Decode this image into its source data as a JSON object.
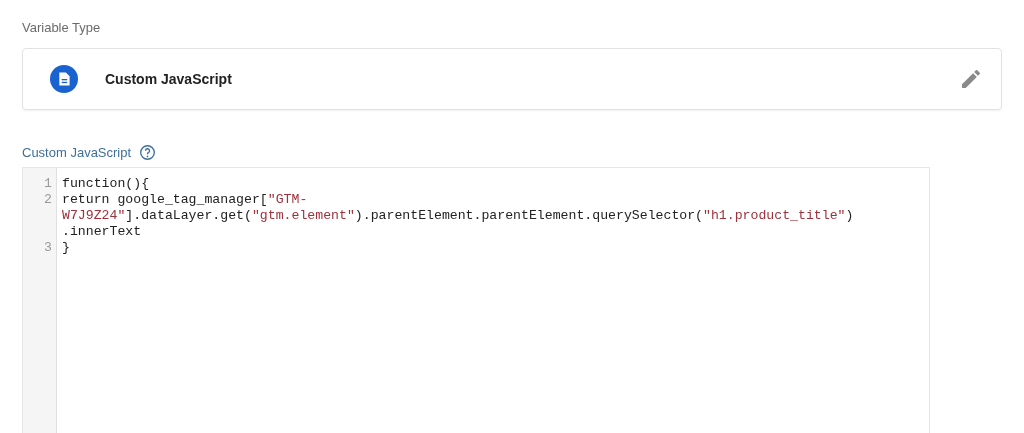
{
  "variable_type": {
    "label": "Variable Type",
    "name": "Custom JavaScript"
  },
  "code_section": {
    "label": "Custom JavaScript",
    "lines": [
      {
        "number": "1",
        "rows": [
          {
            "segments": [
              {
                "kind": "plain",
                "text": "function(){"
              }
            ]
          }
        ]
      },
      {
        "number": "2",
        "rows": [
          {
            "segments": [
              {
                "kind": "plain",
                "text": "return google_tag_manager["
              },
              {
                "kind": "string",
                "text": "\"GTM-"
              }
            ]
          },
          {
            "segments": [
              {
                "kind": "string",
                "text": "W7J9Z24\""
              },
              {
                "kind": "plain",
                "text": "].dataLayer.get("
              },
              {
                "kind": "string",
                "text": "\"gtm.element\""
              },
              {
                "kind": "plain",
                "text": ").parentElement.parentElement.querySelector("
              },
              {
                "kind": "string",
                "text": "\"h1.product_title\""
              },
              {
                "kind": "plain",
                "text": ")"
              }
            ]
          },
          {
            "segments": [
              {
                "kind": "plain",
                "text": ".innerText"
              }
            ]
          }
        ]
      },
      {
        "number": "3",
        "rows": [
          {
            "segments": [
              {
                "kind": "plain",
                "text": "}"
              }
            ]
          }
        ]
      }
    ]
  }
}
